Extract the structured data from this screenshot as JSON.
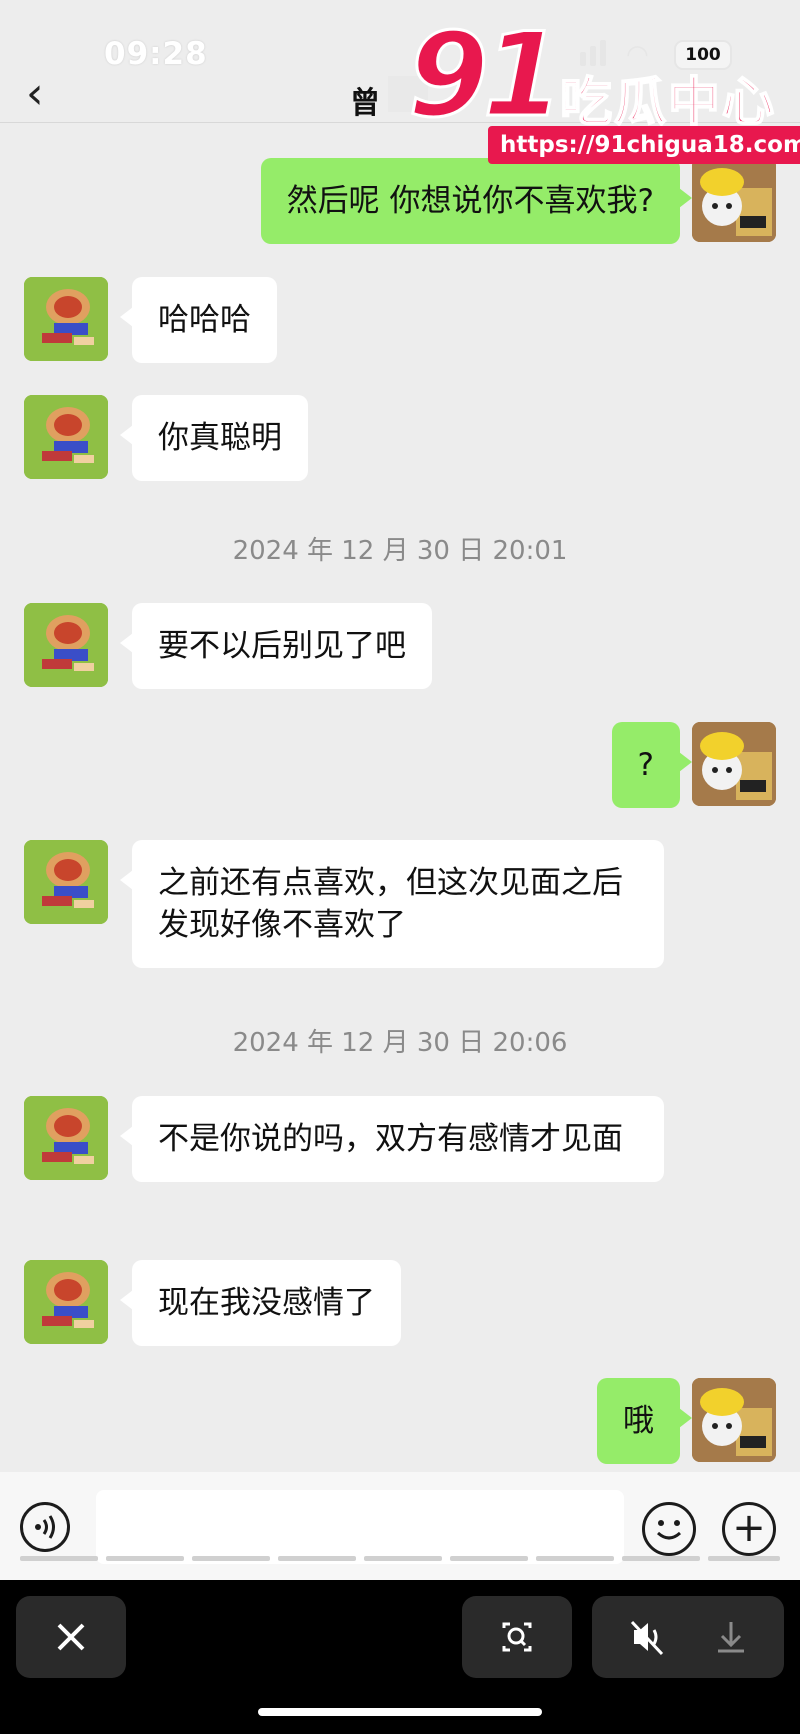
{
  "status_bar": {
    "time": "09:28",
    "battery": "100"
  },
  "header": {
    "back_icon": "chevron-left-icon",
    "title": "曾"
  },
  "watermark": {
    "number": "91",
    "text": "吃瓜中心",
    "url": "https://91chigua18.com"
  },
  "messages": [
    {
      "side": "right",
      "text": "然后呢 你想说你不喜欢我?"
    },
    {
      "side": "left",
      "text": "哈哈哈"
    },
    {
      "side": "left",
      "text": "你真聪明"
    },
    {
      "side": "time",
      "text": "2024 年 12 月 30 日 20:01"
    },
    {
      "side": "left",
      "text": "要不以后别见了吧"
    },
    {
      "side": "right",
      "text": "?"
    },
    {
      "side": "left",
      "text": "之前还有点喜欢，但这次见面之后发现好像不喜欢了"
    },
    {
      "side": "time",
      "text": "2024 年 12 月 30 日 20:06"
    },
    {
      "side": "left",
      "text": "不是你说的吗，双方有感情才见面"
    },
    {
      "side": "left",
      "text": "现在我没感情了"
    },
    {
      "side": "right",
      "text": "哦"
    }
  ],
  "input_bar": {
    "voice_icon": "voice-icon",
    "emoji_icon": "emoji-icon",
    "plus_icon": "plus-icon",
    "text_value": ""
  },
  "viewer_toolbar": {
    "close_icon": "close-icon",
    "scan_icon": "scan-icon",
    "mute_icon": "mute-icon",
    "download_icon": "download-icon"
  },
  "colors": {
    "background": "#ededed",
    "sent_bubble": "#95ec69",
    "received_bubble": "#ffffff",
    "watermark": "#e8184e"
  }
}
